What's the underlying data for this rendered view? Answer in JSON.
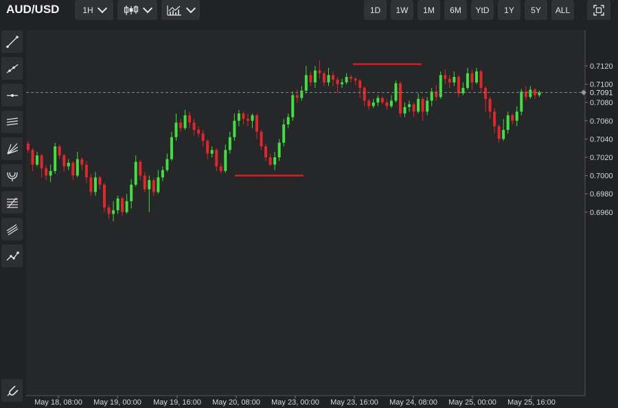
{
  "header": {
    "symbol": "AUD/USD",
    "interval_label": "1H",
    "chart_type_icon": "candles-icon",
    "indicators_icon": "indicators-icon",
    "ranges": [
      "1D",
      "1W",
      "1M",
      "6M",
      "YtD",
      "1Y",
      "5Y",
      "ALL"
    ],
    "fullscreen_icon": "fullscreen-icon"
  },
  "sidebar": {
    "tools": [
      "trend-line-icon",
      "ray-line-icon",
      "horizontal-line-icon",
      "parallel-channel-icon",
      "fan-icon",
      "pitchfork-icon",
      "fibonacci-icon",
      "regression-channel-icon",
      "path-icon"
    ],
    "bottom_tool": "magnet-icon"
  },
  "colors": {
    "background": "#262728",
    "up": "#3fe03f",
    "down": "#e3262c",
    "annotation": "#e01a1a",
    "grid": "#3a3c3f",
    "last_price_line": "#8a8a8a"
  },
  "chart_data": {
    "type": "candlestick",
    "title": "",
    "xlabel": "",
    "ylabel": "",
    "x_tick_labels": [
      "May 18, 08:00",
      "May 19, 00:00",
      "May 19, 16:00",
      "May 20, 08:00",
      "May 23, 00:00",
      "May 23, 16:00",
      "May 24, 08:00",
      "May 25, 00:00",
      "May 25, 16:00"
    ],
    "y_ticks": [
      0.696,
      0.698,
      0.7,
      0.702,
      0.704,
      0.706,
      0.708,
      0.71,
      0.712
    ],
    "y_tick_labels": [
      "0.6960",
      "0.6980",
      "0.7000",
      "0.7020",
      "0.7040",
      "0.7060",
      "0.7080",
      "0.7100",
      "0.7120"
    ],
    "ylim": [
      0.694,
      0.7135
    ],
    "last_price": 0.7091,
    "last_price_label": "0.7091",
    "grid": false,
    "annotations": [
      {
        "type": "horizontal_segment",
        "y": 0.7,
        "from": "May 20, 08:00",
        "to": "May 23, 00:00"
      },
      {
        "type": "horizontal_segment",
        "y": 0.7122,
        "from": "May 23, 16:00",
        "to": "May 24, 08:00"
      }
    ],
    "candles": [
      [
        0.7035,
        0.7028,
        0.7038,
        0.7025
      ],
      [
        0.7028,
        0.7012,
        0.703,
        0.7005
      ],
      [
        0.7012,
        0.7022,
        0.7026,
        0.701
      ],
      [
        0.7022,
        0.7008,
        0.7024,
        0.6998
      ],
      [
        0.7008,
        0.7,
        0.7012,
        0.6995
      ],
      [
        0.7,
        0.7005,
        0.7012,
        0.6993
      ],
      [
        0.7005,
        0.7032,
        0.7036,
        0.7002
      ],
      [
        0.7032,
        0.7022,
        0.7034,
        0.7018
      ],
      [
        0.7022,
        0.701,
        0.7024,
        0.7004
      ],
      [
        0.701,
        0.7014,
        0.7018,
        0.7006
      ],
      [
        0.7014,
        0.7,
        0.7016,
        0.6995
      ],
      [
        0.7,
        0.7018,
        0.7026,
        0.6998
      ],
      [
        0.7018,
        0.7012,
        0.702,
        0.7006
      ],
      [
        0.7012,
        0.6998,
        0.7016,
        0.6992
      ],
      [
        0.6998,
        0.6982,
        0.7002,
        0.6978
      ],
      [
        0.6982,
        0.6998,
        0.7004,
        0.6978
      ],
      [
        0.6998,
        0.699,
        0.7,
        0.6985
      ],
      [
        0.699,
        0.6965,
        0.6992,
        0.696
      ],
      [
        0.6965,
        0.6958,
        0.6968,
        0.6952
      ],
      [
        0.6958,
        0.6962,
        0.6972,
        0.695
      ],
      [
        0.6962,
        0.6975,
        0.6978,
        0.6958
      ],
      [
        0.6975,
        0.696,
        0.6977,
        0.6956
      ],
      [
        0.696,
        0.6972,
        0.698,
        0.6958
      ],
      [
        0.6972,
        0.699,
        0.6996,
        0.6964
      ],
      [
        0.699,
        0.7015,
        0.7022,
        0.6988
      ],
      [
        0.7015,
        0.7,
        0.7017,
        0.6995
      ],
      [
        0.7,
        0.6985,
        0.7004,
        0.6982
      ],
      [
        0.6985,
        0.6995,
        0.7,
        0.696
      ],
      [
        0.6995,
        0.6982,
        0.6998,
        0.6978
      ],
      [
        0.6982,
        0.6998,
        0.7006,
        0.698
      ],
      [
        0.6998,
        0.7006,
        0.701,
        0.6994
      ],
      [
        0.7006,
        0.7018,
        0.7024,
        0.7004
      ],
      [
        0.7018,
        0.7042,
        0.7048,
        0.7016
      ],
      [
        0.7042,
        0.7058,
        0.7068,
        0.7038
      ],
      [
        0.7058,
        0.7052,
        0.7062,
        0.7048
      ],
      [
        0.7052,
        0.7066,
        0.7072,
        0.705
      ],
      [
        0.7066,
        0.7058,
        0.707,
        0.7052
      ],
      [
        0.7058,
        0.705,
        0.7062,
        0.7044
      ],
      [
        0.705,
        0.7046,
        0.7054,
        0.7042
      ],
      [
        0.7046,
        0.7038,
        0.705,
        0.7032
      ],
      [
        0.7038,
        0.7024,
        0.704,
        0.7018
      ],
      [
        0.7024,
        0.7028,
        0.7032,
        0.702
      ],
      [
        0.7028,
        0.701,
        0.703,
        0.7005
      ],
      [
        0.701,
        0.7005,
        0.7014,
        0.7002
      ],
      [
        0.7005,
        0.7028,
        0.7034,
        0.7003
      ],
      [
        0.7028,
        0.7042,
        0.7048,
        0.7024
      ],
      [
        0.7042,
        0.706,
        0.7068,
        0.7038
      ],
      [
        0.706,
        0.7068,
        0.7072,
        0.7054
      ],
      [
        0.7068,
        0.7062,
        0.707,
        0.7056
      ],
      [
        0.7062,
        0.706,
        0.7068,
        0.7054
      ],
      [
        0.706,
        0.7066,
        0.7068,
        0.7052
      ],
      [
        0.7066,
        0.7048,
        0.7068,
        0.704
      ],
      [
        0.7048,
        0.7032,
        0.705,
        0.7028
      ],
      [
        0.7032,
        0.702,
        0.7035,
        0.7016
      ],
      [
        0.702,
        0.7012,
        0.7024,
        0.701
      ],
      [
        0.7012,
        0.702,
        0.7026,
        0.7006
      ],
      [
        0.702,
        0.7036,
        0.704,
        0.7016
      ],
      [
        0.7036,
        0.7056,
        0.7062,
        0.7032
      ],
      [
        0.7056,
        0.7064,
        0.7068,
        0.7052
      ],
      [
        0.7064,
        0.7088,
        0.7092,
        0.706
      ],
      [
        0.7088,
        0.7085,
        0.7094,
        0.708
      ],
      [
        0.7085,
        0.7093,
        0.7098,
        0.7082
      ],
      [
        0.7093,
        0.711,
        0.712,
        0.709
      ],
      [
        0.711,
        0.7102,
        0.7114,
        0.7098
      ],
      [
        0.7102,
        0.7115,
        0.712,
        0.7096
      ],
      [
        0.7115,
        0.7112,
        0.7126,
        0.7106
      ],
      [
        0.7112,
        0.7102,
        0.7114,
        0.7098
      ],
      [
        0.7102,
        0.711,
        0.7118,
        0.7098
      ],
      [
        0.711,
        0.7105,
        0.7114,
        0.7098
      ],
      [
        0.7105,
        0.71,
        0.7108,
        0.709
      ],
      [
        0.71,
        0.7102,
        0.7106,
        0.7096
      ],
      [
        0.7102,
        0.7108,
        0.7112,
        0.71
      ],
      [
        0.7108,
        0.7106,
        0.711,
        0.7102
      ],
      [
        0.7106,
        0.7104,
        0.7108,
        0.7099
      ],
      [
        0.7104,
        0.7096,
        0.7106,
        0.7085
      ],
      [
        0.7096,
        0.7082,
        0.7098,
        0.7076
      ],
      [
        0.7082,
        0.7076,
        0.7084,
        0.7072
      ],
      [
        0.7076,
        0.708,
        0.7084,
        0.7074
      ],
      [
        0.708,
        0.7085,
        0.7088,
        0.7076
      ],
      [
        0.7085,
        0.708,
        0.7087,
        0.7078
      ],
      [
        0.708,
        0.7076,
        0.7083,
        0.7072
      ],
      [
        0.7076,
        0.7082,
        0.7088,
        0.7074
      ],
      [
        0.7082,
        0.7101,
        0.7104,
        0.708
      ],
      [
        0.7101,
        0.7068,
        0.7103,
        0.7064
      ],
      [
        0.7068,
        0.7075,
        0.708,
        0.7064
      ],
      [
        0.7075,
        0.7078,
        0.7082,
        0.707
      ],
      [
        0.7078,
        0.707,
        0.708,
        0.7064
      ],
      [
        0.707,
        0.7084,
        0.709,
        0.7068
      ],
      [
        0.7084,
        0.707,
        0.7086,
        0.706
      ],
      [
        0.707,
        0.7082,
        0.7086,
        0.7066
      ],
      [
        0.7082,
        0.7092,
        0.7096,
        0.7076
      ],
      [
        0.7092,
        0.7086,
        0.7099,
        0.7082
      ],
      [
        0.7086,
        0.711,
        0.7114,
        0.7084
      ],
      [
        0.711,
        0.7106,
        0.7116,
        0.71
      ],
      [
        0.7106,
        0.7102,
        0.711,
        0.7096
      ],
      [
        0.7102,
        0.7108,
        0.7114,
        0.7098
      ],
      [
        0.7108,
        0.709,
        0.711,
        0.7086
      ],
      [
        0.709,
        0.7096,
        0.7102,
        0.7088
      ],
      [
        0.7096,
        0.7112,
        0.7118,
        0.7094
      ],
      [
        0.7112,
        0.7102,
        0.7116,
        0.7094
      ],
      [
        0.7102,
        0.7114,
        0.7118,
        0.71
      ],
      [
        0.7114,
        0.7096,
        0.7116,
        0.709
      ],
      [
        0.7096,
        0.7084,
        0.7098,
        0.707
      ],
      [
        0.7084,
        0.707,
        0.7086,
        0.7062
      ],
      [
        0.707,
        0.7054,
        0.7074,
        0.7046
      ],
      [
        0.7054,
        0.704,
        0.7056,
        0.7036
      ],
      [
        0.704,
        0.705,
        0.7062,
        0.7038
      ],
      [
        0.705,
        0.7066,
        0.707,
        0.7046
      ],
      [
        0.7066,
        0.706,
        0.7068,
        0.7056
      ],
      [
        0.706,
        0.707,
        0.7076,
        0.7054
      ],
      [
        0.707,
        0.7092,
        0.7095,
        0.7066
      ],
      [
        0.7092,
        0.7086,
        0.7098,
        0.7082
      ],
      [
        0.7086,
        0.7094,
        0.7098,
        0.7084
      ],
      [
        0.7094,
        0.7088,
        0.7096,
        0.7084
      ],
      [
        0.7088,
        0.7091,
        0.7093,
        0.7086
      ]
    ]
  }
}
